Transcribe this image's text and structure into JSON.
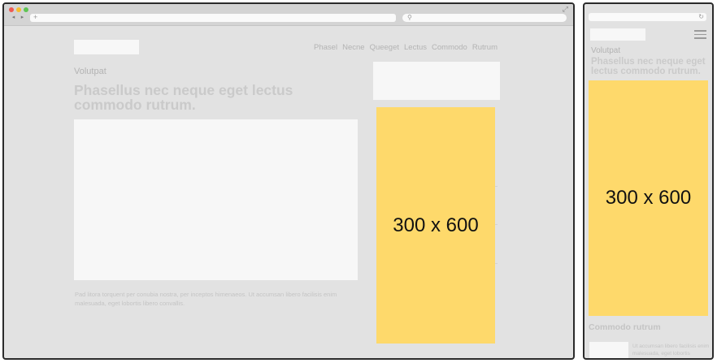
{
  "desktop": {
    "nav_links": [
      "Phasel",
      "Necne",
      "Queeget",
      "Lectus",
      "Commodo",
      "Rutrum"
    ],
    "eyebrow": "Volutpat",
    "headline": "Phasellus nec neque eget lectus commodo rutrum.",
    "body_text": "Pad litora torquent per conubia nostra, per inceptos himenaeos. Ut accumsan libero facilisis enim malesuada, eget lobortis libero convallis.",
    "ad_label": "300 x 600"
  },
  "mobile": {
    "eyebrow": "Volutpat",
    "headline": "Phasellus nec neque eget lectus commodo rutrum.",
    "ad_label": "300 x 600",
    "section_title": "Commodo rutrum",
    "body_text": "Ut accumsan libero facilisis enim malesuada, eget lobortis"
  },
  "icons": {
    "back": "◂",
    "forward": "▸",
    "new_tab": "+",
    "search": "⚲",
    "expand": "⤢",
    "reload": "↻"
  },
  "colors": {
    "page_background": "#e2e2e2",
    "placeholder_block": "#f7f7f7",
    "ad_yellow": "#fed96b",
    "frame_border": "#2b2b2b"
  }
}
